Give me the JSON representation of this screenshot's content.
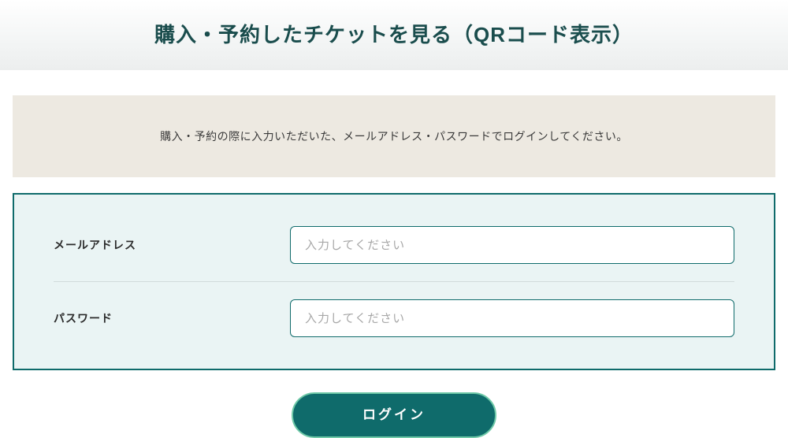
{
  "header": {
    "title": "購入・予約したチケットを見る（QRコード表示）"
  },
  "instruction": {
    "text": "購入・予約の際に入力いただいた、メールアドレス・パスワードでログインしてください。"
  },
  "form": {
    "email": {
      "label": "メールアドレス",
      "placeholder": "入力してください"
    },
    "password": {
      "label": "パスワード",
      "placeholder": "入力してください"
    }
  },
  "actions": {
    "login_label": "ログイン"
  }
}
